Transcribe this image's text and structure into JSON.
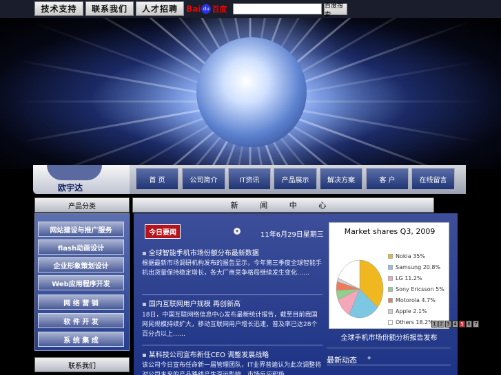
{
  "topbar": {
    "buttons": [
      "技术支持",
      "联系我们",
      "人才招聘"
    ],
    "baidu": {
      "bai": "Bai",
      "paw": "du",
      "du": "百度"
    },
    "search_button": "百度搜索"
  },
  "logo": {
    "name": "欧宇达"
  },
  "nav": [
    "首  页",
    "公司简介",
    "IT资讯",
    "产品展示",
    "解决方案",
    "客  户",
    "在线留言"
  ],
  "sidebar": {
    "head1": "产品分类",
    "items": [
      "网站建设与推广服务",
      "flash动画设计",
      "企业形象策划设计",
      "Web应用程序开发",
      "网 络 营 销",
      "软 件 开 发",
      "系 统 集 成"
    ],
    "head2": "联系我们"
  },
  "main": {
    "head": "新 闻 中 心",
    "badge": "今日要闻",
    "date": "11年6月29日星期三",
    "news": [
      {
        "title": "全球智能手机市场份额分布最新数据",
        "body": "根据最新市场调研机构发布的报告显示，今年第三季度全球智能手机出货量保持稳定增长，各大厂商竞争格局继续发生变化……"
      },
      {
        "title": "国内互联网用户规模 再创新高",
        "body": "18日，中国互联网络信息中心发布最新统计报告，截至目前我国网民规模持续扩大，移动互联网用户增长迅速，普及率已达28个百分点以上……"
      },
      {
        "title": "某科技公司宣布新任CEO 调整发展战略",
        "body": "该公司今日宣布任命新一届管理团队，IT业界普遍认为此次调整将对公司未来的产品路线产生深远影响，市场反应积极……"
      }
    ],
    "chart_caption": "全球手机市场份额分析报告发布",
    "subhead": "最新动态",
    "pager": [
      "1",
      "2",
      "3",
      "4",
      "5",
      "6",
      "7"
    ],
    "pager_active": 5
  },
  "chart_data": {
    "type": "pie",
    "title": "Market shares Q3, 2009",
    "slices": [
      {
        "label": "Nokia  35%",
        "value": 35,
        "color": "#f0b820"
      },
      {
        "label": "Samsung 20.8%",
        "value": 20.8,
        "color": "#7ec7e3"
      },
      {
        "label": "LG  11.2%",
        "value": 11.2,
        "color": "#f3a7b8"
      },
      {
        "label": "Sony Ericsson  5%",
        "value": 5,
        "color": "#8fd08a"
      },
      {
        "label": "Motorola  4.7%",
        "value": 4.7,
        "color": "#ef7a5a"
      },
      {
        "label": "Apple 2.1%",
        "value": 2.1,
        "color": "#d0d0d0"
      },
      {
        "label": "Others 18.2%",
        "value": 18.2,
        "color": "#ffffff"
      }
    ]
  }
}
